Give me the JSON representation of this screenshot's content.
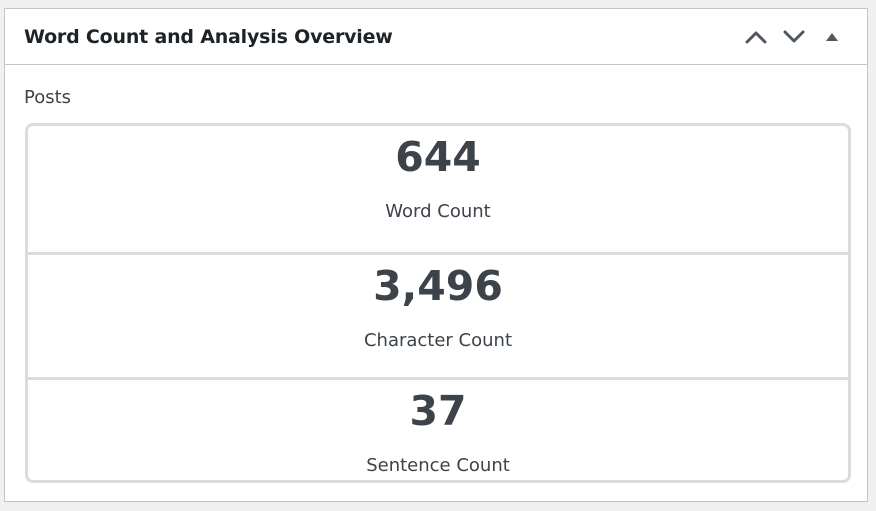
{
  "widget": {
    "title": "Word Count and Analysis Overview",
    "controls": {
      "move_up_icon": "chevron-up-icon",
      "move_down_icon": "chevron-down-icon",
      "toggle_icon": "triangle-up-icon"
    }
  },
  "section": {
    "label": "Posts"
  },
  "stats": [
    {
      "value": "644",
      "label": "Word Count"
    },
    {
      "value": "3,496",
      "label": "Character Count"
    },
    {
      "value": "37",
      "label": "Sentence Count"
    }
  ],
  "colors": {
    "text": "#3c434a",
    "border": "#dcdcde",
    "frame": "#c3c4c7",
    "background": "#f0f0f1"
  }
}
